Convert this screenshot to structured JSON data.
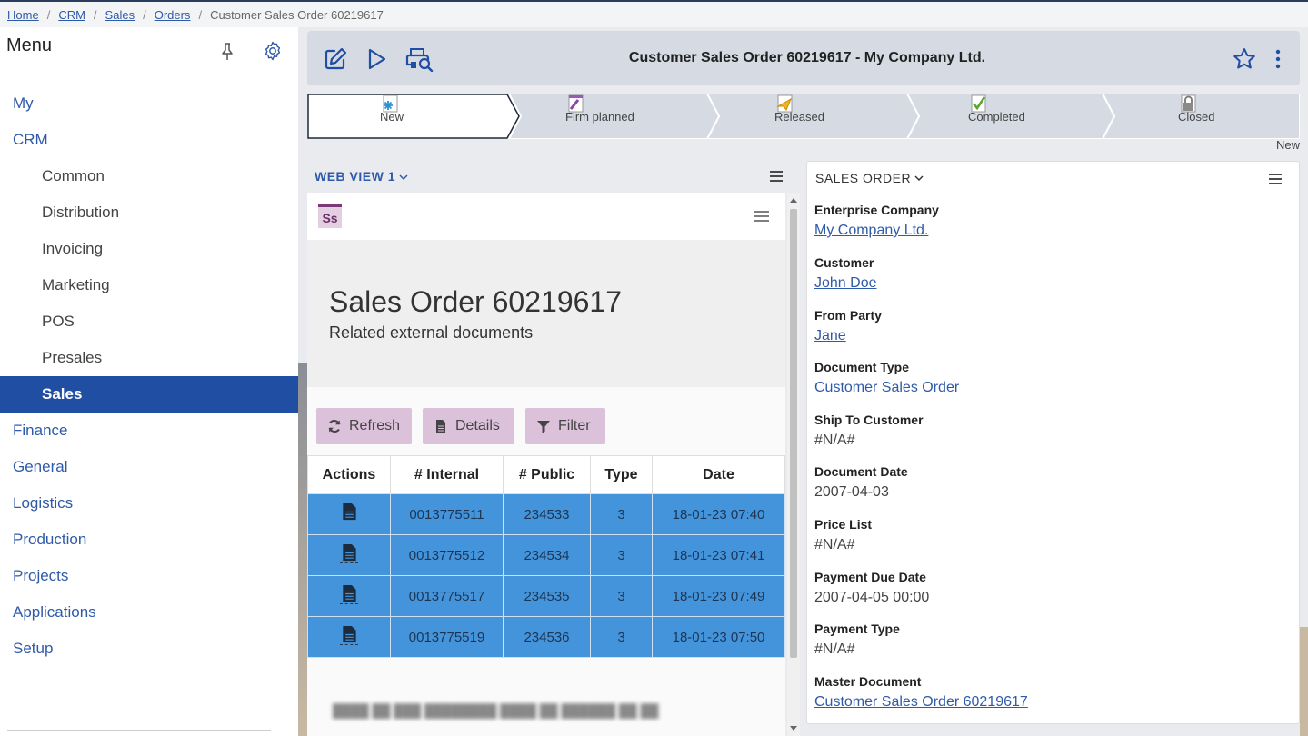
{
  "breadcrumb": {
    "items": [
      "Home",
      "CRM",
      "Sales",
      "Orders"
    ],
    "current": "Customer Sales Order 60219617"
  },
  "sidebar": {
    "title": "Menu",
    "items": [
      {
        "label": "My"
      },
      {
        "label": "CRM"
      },
      {
        "label": "Common"
      },
      {
        "label": "Distribution"
      },
      {
        "label": "Invoicing"
      },
      {
        "label": "Marketing"
      },
      {
        "label": "POS"
      },
      {
        "label": "Presales"
      },
      {
        "label": "Sales"
      },
      {
        "label": "Finance"
      },
      {
        "label": "General"
      },
      {
        "label": "Logistics"
      },
      {
        "label": "Production"
      },
      {
        "label": "Projects"
      },
      {
        "label": "Applications"
      },
      {
        "label": "Setup"
      }
    ]
  },
  "toolbar": {
    "title": "Customer Sales Order 60219617 - My Company Ltd."
  },
  "flow": {
    "steps": [
      {
        "label": "New"
      },
      {
        "label": "Firm planned"
      },
      {
        "label": "Released"
      },
      {
        "label": "Completed"
      },
      {
        "label": "Closed"
      }
    ],
    "status": "New"
  },
  "webview": {
    "title": "WEB VIEW 1",
    "logo": "Ss",
    "heading": "Sales Order 60219617",
    "subheading": "Related external documents",
    "buttons": {
      "refresh": "Refresh",
      "details": "Details",
      "filter": "Filter"
    },
    "columns": [
      "Actions",
      "# Internal",
      "# Public",
      "Type",
      "Date"
    ],
    "rows": [
      {
        "internal": "0013775511",
        "public": "234533",
        "type": "3",
        "date": "18-01-23 07:40"
      },
      {
        "internal": "0013775512",
        "public": "234534",
        "type": "3",
        "date": "18-01-23 07:41"
      },
      {
        "internal": "0013775517",
        "public": "234535",
        "type": "3",
        "date": "18-01-23 07:49"
      },
      {
        "internal": "0013775519",
        "public": "234536",
        "type": "3",
        "date": "18-01-23 07:50"
      }
    ]
  },
  "sales_order": {
    "title": "SALES ORDER",
    "fields": [
      {
        "label": "Enterprise Company",
        "value": "My Company Ltd.",
        "link": true
      },
      {
        "label": "Customer",
        "value": "John Doe",
        "link": true
      },
      {
        "label": "From Party",
        "value": "Jane",
        "link": true
      },
      {
        "label": "Document Type",
        "value": "Customer Sales Order",
        "link": true
      },
      {
        "label": "Ship To Customer",
        "value": "#N/A#",
        "link": false
      },
      {
        "label": "Document Date",
        "value": "2007-04-03",
        "link": false
      },
      {
        "label": "Price List",
        "value": "#N/A#",
        "link": false
      },
      {
        "label": "Payment Due Date",
        "value": "2007-04-05 00:00",
        "link": false
      },
      {
        "label": "Payment Type",
        "value": "#N/A#",
        "link": false
      },
      {
        "label": "Master Document",
        "value": "Customer Sales Order 60219617",
        "link": true
      }
    ]
  },
  "colors": {
    "accent": "#1f4ea3",
    "link": "#2f5aa8",
    "row": "#4494dc",
    "button": "#dcc1db",
    "toolbar": "#d5dae3"
  }
}
